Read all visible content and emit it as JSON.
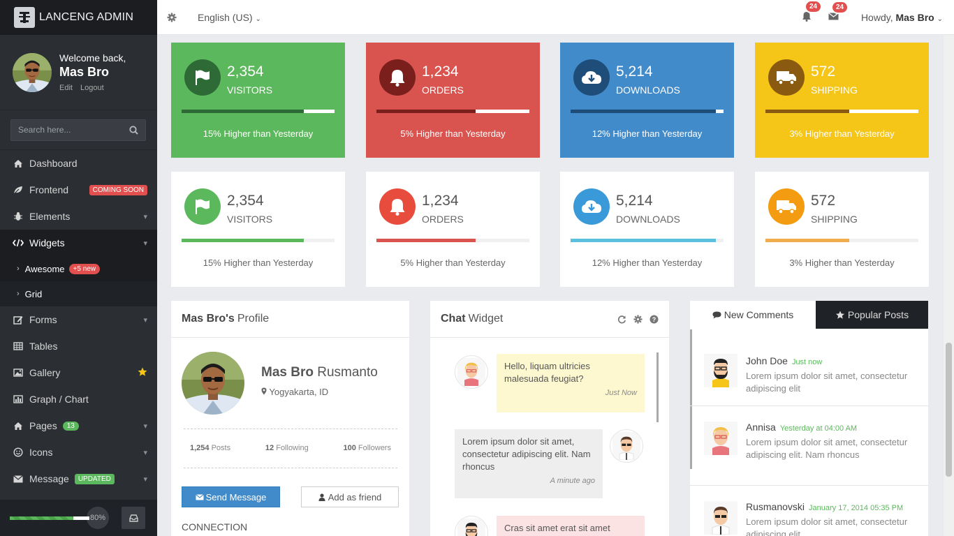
{
  "brand": {
    "name": "LANCENG ADMIN"
  },
  "user": {
    "welcome": "Welcome back,",
    "name": "Mas Bro",
    "edit": "Edit",
    "logout": "Logout"
  },
  "search": {
    "placeholder": "Search here..."
  },
  "menu": [
    {
      "label": "Dashboard",
      "icon": "home-icon"
    },
    {
      "label": "Frontend",
      "icon": "leaf-icon",
      "badge": "COMING SOON"
    },
    {
      "label": "Elements",
      "icon": "bug-icon"
    },
    {
      "label": "Widgets",
      "icon": "code-icon"
    },
    {
      "label": "Awesome",
      "badge": "+5 new"
    },
    {
      "label": "Grid"
    },
    {
      "label": "Forms",
      "icon": "edit-icon"
    },
    {
      "label": "Tables",
      "icon": "table-icon"
    },
    {
      "label": "Gallery",
      "icon": "image-icon"
    },
    {
      "label": "Graph / Chart",
      "icon": "bar-chart-icon"
    },
    {
      "label": "Pages",
      "icon": "home-icon",
      "badge": "13"
    },
    {
      "label": "Icons",
      "icon": "smile-icon"
    },
    {
      "label": "Message",
      "icon": "envelope-icon",
      "badge": "UPDATED"
    }
  ],
  "sidebar_footer": {
    "progress_label": "80%",
    "progress": 0.8
  },
  "topbar": {
    "language": "English (US)",
    "notifications_count": "24",
    "messages_count": "24",
    "howdy": "Howdy,",
    "howdy_name": "Mas Bro"
  },
  "colors": {
    "green": "#5cb85c",
    "red": "#d9534f",
    "blue": "#428bca",
    "yellow": "#f5c518",
    "sidebar": "#2b2e33"
  },
  "tiles_solid": [
    {
      "number": "2,354",
      "caption": "VISITORS",
      "footer": "15% Higher than Yesterday",
      "icon": "flag-icon",
      "progress": 0.8
    },
    {
      "number": "1,234",
      "caption": "ORDERS",
      "footer": "5% Higher than Yesterday",
      "icon": "bell-icon",
      "progress": 0.65
    },
    {
      "number": "5,214",
      "caption": "DOWNLOADS",
      "footer": "12% Higher than Yesterday",
      "icon": "cloud-download-icon",
      "progress": 0.95
    },
    {
      "number": "572",
      "caption": "SHIPPING",
      "footer": "3% Higher than Yesterday",
      "icon": "truck-icon",
      "progress": 0.55
    }
  ],
  "tiles_plain": [
    {
      "number": "2,354",
      "caption": "VISITORS",
      "footer": "15% Higher than Yesterday",
      "icon": "flag-icon",
      "progress": 0.8
    },
    {
      "number": "1,234",
      "caption": "ORDERS",
      "footer": "5% Higher than Yesterday",
      "icon": "bell-icon",
      "progress": 0.65
    },
    {
      "number": "5,214",
      "caption": "DOWNLOADS",
      "footer": "12% Higher than Yesterday",
      "icon": "cloud-download-icon",
      "progress": 0.95
    },
    {
      "number": "572",
      "caption": "SHIPPING",
      "footer": "3% Higher than Yesterday",
      "icon": "truck-icon",
      "progress": 0.55
    }
  ],
  "profile": {
    "title_bold": "Mas Bro's",
    "title_rest": "Profile",
    "first_name": "Mas Bro",
    "last_name": "Rusmanto",
    "location": "Yogyakarta, ID",
    "posts_count": "1,254",
    "posts_label": "Posts",
    "following_count": "12",
    "following_label": "Following",
    "followers_count": "100",
    "followers_label": "Followers",
    "send_message": "Send Message",
    "add_friend": "Add as friend",
    "connection": "CONNECTION"
  },
  "chat": {
    "title_bold": "Chat",
    "title_rest": "Widget",
    "messages": [
      {
        "text": "Hello, liquam ultricies malesuada feugiat?",
        "time": "Just Now"
      },
      {
        "text": "Lorem ipsum dolor sit amet, consectetur adipiscing elit. Nam rhoncus",
        "time": "A minute ago"
      },
      {
        "text": "Cras sit amet erat sit amet"
      }
    ]
  },
  "comments_tabs": {
    "new": "New Comments",
    "popular": "Popular Posts"
  },
  "comments": [
    {
      "name": "John Doe",
      "time": "Just now",
      "text": "Lorem ipsum dolor sit amet, consectetur adipiscing elit"
    },
    {
      "name": "Annisa",
      "time": "Yesterday at 04:00 AM",
      "text": "Lorem ipsum dolor sit amet, consectetur adipiscing elit. Nam rhoncus"
    },
    {
      "name": "Rusmanovski",
      "time": "January 17, 2014 05:35 PM",
      "text": "Lorem ipsum dolor sit amet, consectetur adipiscing elit"
    }
  ]
}
